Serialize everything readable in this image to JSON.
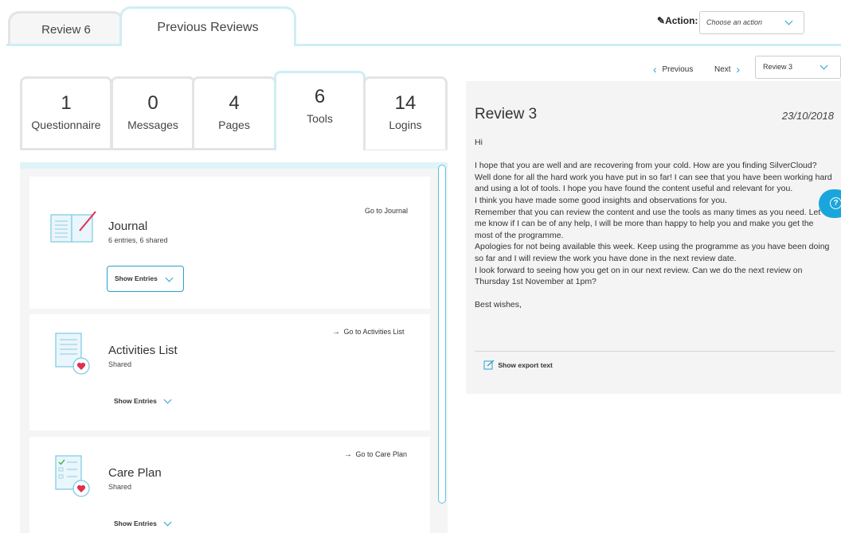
{
  "top_tabs": {
    "tab_review6": "Review 6",
    "tab_previous": "Previous Reviews"
  },
  "action": {
    "label": "Action:",
    "placeholder": "Choose an action"
  },
  "review_nav": {
    "previous": "Previous",
    "next": "Next",
    "selected": "Review 3"
  },
  "stats": [
    {
      "count": "1",
      "label": "Questionnaire"
    },
    {
      "count": "0",
      "label": "Messages"
    },
    {
      "count": "4",
      "label": "Pages"
    },
    {
      "count": "6",
      "label": "Tools"
    },
    {
      "count": "14",
      "label": "Logins"
    }
  ],
  "tools": [
    {
      "title": "Journal",
      "subtitle": "6 entries, 6 shared",
      "goto": "Go to Journal",
      "show": "Show Entries"
    },
    {
      "title": "Activities List",
      "subtitle": "Shared",
      "goto": "Go to Activities List",
      "show": "Show Entries"
    },
    {
      "title": "Care Plan",
      "subtitle": "Shared",
      "goto": "Go to Care Plan",
      "show": "Show Entries"
    }
  ],
  "review": {
    "title": "Review 3",
    "date": "23/10/2018",
    "greeting": "Hi",
    "paragraph1": "I hope that you are well and are recovering from your cold. How are you finding SilverCloud? Well done for all the hard work you have put in so far! I can see that you have been working hard and using a lot of tools. I hope you have found the content useful and relevant for you.",
    "paragraph2": "I think you have made some good insights and observations for you.",
    "paragraph3": "Remember that you can review the content and use the tools as many times as you need. Let me know if I can be of any help, I will be more than happy to help you and make you get the most of the programme.",
    "paragraph4": "Apologies for not being available this week. Keep using the programme as you have been doing so far and I will review the work you have done in the next review date.",
    "paragraph5": "I look forward to seeing how you get on in our next review. Can we do the next review on Thursday 1st November at 1pm?",
    "signoff": "Best wishes,",
    "export_label": "Show export text"
  },
  "colors": {
    "accent": "#2aa0d0",
    "tab_border_active": "#cdeef5",
    "help_button": "#1aa6dc",
    "heart": "#e0304e"
  }
}
